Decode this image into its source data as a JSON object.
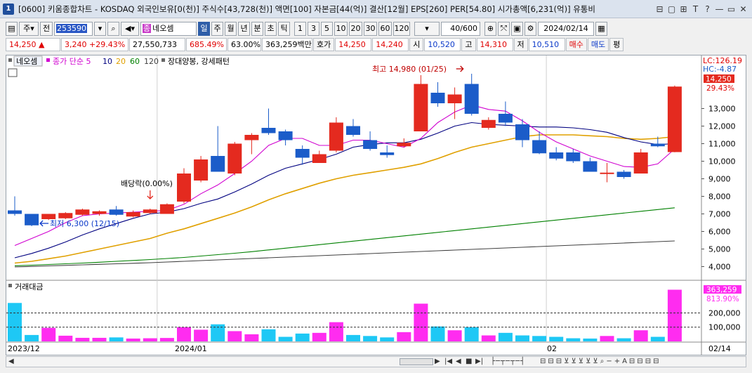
{
  "window": {
    "number": "1",
    "title": "[0600] 키움종합차트 - KOSDAQ 외국인보유[0(천)] 주식수[43,728(천)] 액면[100] 자본금[44(억)] 결산[12월] EPS[260] PER[54.80] 시가총액[6,231(억)] 유통비",
    "buttons": [
      "⊟",
      "▢",
      "⊞",
      "T",
      "?",
      "—",
      "▭",
      "✕"
    ]
  },
  "toolbar": {
    "mode_label": "주",
    "full_label": "전",
    "stock_code": "253590",
    "stock_name": "네오셈",
    "stock_badge": "종",
    "periods": [
      "일",
      "주",
      "월",
      "년",
      "분",
      "초",
      "틱"
    ],
    "active_period": "일",
    "intervals": [
      "1",
      "3",
      "5",
      "10",
      "20",
      "30",
      "60",
      "120"
    ],
    "count": "40/600",
    "date": "2024/02/14"
  },
  "quote": {
    "price": "14,250",
    "change": "3,240",
    "change_pct": "+29.43%",
    "volume": "27,550,733",
    "volume_pct": "685.49%",
    "ratio": "63.00%",
    "amount": "363,259백만",
    "ask_label": "호가",
    "ask": "14,250",
    "bid": "14,240",
    "open_label": "시",
    "open": "10,520",
    "high_label": "고",
    "high": "14,310",
    "low_label": "저",
    "low": "10,510",
    "buy_label": "매수",
    "sell_label": "매도",
    "flat_label": "평"
  },
  "chart_data": {
    "type": "candlestick",
    "title": "네오셈",
    "legend": [
      "종가 단순 5",
      "10",
      "20",
      "60",
      "120"
    ],
    "legend_colors": [
      "#d000d0",
      "#000080",
      "#e0a000",
      "#008000",
      "#404040"
    ],
    "pattern_label": "장대양봉, 강세패턴",
    "candles": [
      {
        "o": 7200,
        "h": 8000,
        "l": 6900,
        "c": 7000
      },
      {
        "o": 7000,
        "h": 7000,
        "l": 6300,
        "c": 6350
      },
      {
        "o": 6700,
        "h": 7000,
        "l": 6650,
        "c": 7000
      },
      {
        "o": 6750,
        "h": 7100,
        "l": 6700,
        "c": 7050
      },
      {
        "o": 6950,
        "h": 7300,
        "l": 6900,
        "c": 7250
      },
      {
        "o": 7000,
        "h": 7200,
        "l": 6900,
        "c": 7150
      },
      {
        "o": 7250,
        "h": 7450,
        "l": 6900,
        "c": 6950
      },
      {
        "o": 6850,
        "h": 7200,
        "l": 6800,
        "c": 7100
      },
      {
        "o": 7050,
        "h": 7300,
        "l": 7000,
        "c": 7250
      },
      {
        "o": 7000,
        "h": 7600,
        "l": 7000,
        "c": 7550
      },
      {
        "o": 7700,
        "h": 9600,
        "l": 7600,
        "c": 9300
      },
      {
        "o": 8900,
        "h": 10300,
        "l": 8800,
        "c": 10100
      },
      {
        "o": 10300,
        "h": 12000,
        "l": 9400,
        "c": 9400
      },
      {
        "o": 9300,
        "h": 11100,
        "l": 9200,
        "c": 11000
      },
      {
        "o": 11200,
        "h": 11600,
        "l": 10400,
        "c": 11500
      },
      {
        "o": 11900,
        "h": 13000,
        "l": 11500,
        "c": 11600
      },
      {
        "o": 11700,
        "h": 11800,
        "l": 10900,
        "c": 11200
      },
      {
        "o": 10700,
        "h": 10900,
        "l": 9800,
        "c": 10200
      },
      {
        "o": 9900,
        "h": 10600,
        "l": 9900,
        "c": 10400
      },
      {
        "o": 10600,
        "h": 12500,
        "l": 10500,
        "c": 12200
      },
      {
        "o": 12000,
        "h": 12400,
        "l": 11400,
        "c": 11500
      },
      {
        "o": 11200,
        "h": 11700,
        "l": 10600,
        "c": 10700
      },
      {
        "o": 10500,
        "h": 10900,
        "l": 10200,
        "c": 10350
      },
      {
        "o": 10850,
        "h": 11300,
        "l": 10800,
        "c": 11050
      },
      {
        "o": 11700,
        "h": 14900,
        "l": 11700,
        "c": 14400
      },
      {
        "o": 13900,
        "h": 14500,
        "l": 13100,
        "c": 13300
      },
      {
        "o": 13300,
        "h": 14200,
        "l": 12400,
        "c": 13800
      },
      {
        "o": 14400,
        "h": 14980,
        "l": 12600,
        "c": 12700
      },
      {
        "o": 11900,
        "h": 12500,
        "l": 11800,
        "c": 12350
      },
      {
        "o": 12700,
        "h": 13400,
        "l": 12000,
        "c": 12200
      },
      {
        "o": 12100,
        "h": 12400,
        "l": 10800,
        "c": 11200
      },
      {
        "o": 11200,
        "h": 11700,
        "l": 10400,
        "c": 10450
      },
      {
        "o": 10500,
        "h": 10800,
        "l": 10050,
        "c": 10150
      },
      {
        "o": 10500,
        "h": 10700,
        "l": 9900,
        "c": 10000
      },
      {
        "o": 10000,
        "h": 10200,
        "l": 9400,
        "c": 9400
      },
      {
        "o": 9300,
        "h": 9900,
        "l": 8800,
        "c": 9350
      },
      {
        "o": 9400,
        "h": 9500,
        "l": 9000,
        "c": 9100
      },
      {
        "o": 9300,
        "h": 10700,
        "l": 9300,
        "c": 10500
      },
      {
        "o": 11000,
        "h": 11400,
        "l": 10800,
        "c": 10850
      },
      {
        "o": 10520,
        "h": 14310,
        "l": 10510,
        "c": 14250
      }
    ],
    "ma5": [
      5200,
      5600,
      6000,
      6500,
      6900,
      7000,
      7050,
      7100,
      7150,
      7200,
      7550,
      8150,
      8650,
      9300,
      10000,
      10900,
      11300,
      11300,
      10900,
      10900,
      11200,
      11200,
      11000,
      10800,
      11300,
      12200,
      12800,
      13200,
      12950,
      12850,
      12300,
      11650,
      11100,
      10700,
      10300,
      10000,
      9700,
      9650,
      9850,
      10700
    ],
    "ma10": [
      4500,
      4750,
      5050,
      5400,
      5800,
      6150,
      6450,
      6750,
      7000,
      7100,
      7300,
      7600,
      7850,
      8250,
      8700,
      9200,
      9600,
      9850,
      10100,
      10400,
      10800,
      10950,
      11050,
      11050,
      11250,
      11600,
      12000,
      12200,
      12100,
      12050,
      12000,
      11950,
      11950,
      11900,
      11800,
      11650,
      11350,
      11100,
      10950,
      11000
    ],
    "ma20": [
      4200,
      4300,
      4450,
      4600,
      4800,
      5000,
      5200,
      5400,
      5600,
      5900,
      6150,
      6450,
      6750,
      7050,
      7400,
      7800,
      8150,
      8450,
      8750,
      9000,
      9200,
      9350,
      9500,
      9650,
      9850,
      10150,
      10500,
      10800,
      11000,
      11200,
      11400,
      11500,
      11500,
      11500,
      11450,
      11400,
      11300,
      11250,
      11300,
      11400
    ],
    "ma60": [
      4050,
      4080,
      4120,
      4160,
      4200,
      4250,
      4300,
      4350,
      4400,
      4460,
      4520,
      4600,
      4680,
      4760,
      4850,
      4950,
      5050,
      5150,
      5250,
      5350,
      5450,
      5550,
      5650,
      5750,
      5850,
      5950,
      6050,
      6150,
      6250,
      6350,
      6450,
      6550,
      6650,
      6750,
      6850,
      6950,
      7050,
      7150,
      7250,
      7350
    ],
    "ma120": [
      3980,
      4010,
      4040,
      4070,
      4100,
      4130,
      4160,
      4190,
      4220,
      4260,
      4300,
      4340,
      4380,
      4420,
      4460,
      4500,
      4540,
      4580,
      4620,
      4660,
      4700,
      4740,
      4780,
      4820,
      4860,
      4900,
      4940,
      4980,
      5020,
      5060,
      5100,
      5140,
      5180,
      5220,
      5260,
      5300,
      5340,
      5380,
      5420,
      5460
    ],
    "volume_amount": [
      270,
      45,
      95,
      40,
      25,
      25,
      28,
      20,
      22,
      24,
      100,
      82,
      120,
      72,
      50,
      85,
      32,
      55,
      60,
      135,
      45,
      38,
      28,
      65,
      265,
      105,
      78,
      100,
      42,
      60,
      42,
      38,
      32,
      22,
      20,
      38,
      22,
      78,
      32,
      363
    ],
    "price_ylim": [
      3700,
      15300
    ],
    "price_ticks": [
      "4,000",
      "5,000",
      "6,000",
      "7,000",
      "8,000",
      "9,000",
      "10,000",
      "11,000",
      "12,000",
      "13,000"
    ],
    "volume_ticks": [
      "100,000",
      "200,000"
    ],
    "volume_label": "거래대금",
    "x_labels": [
      "2023/12",
      "2024/01",
      "02",
      "02/14"
    ],
    "annotations": {
      "high": "최고 14,980 (01/25)",
      "low": "최저 6,300 (12/15)",
      "dividend": "배당락(0.00%)"
    },
    "right_labels": {
      "lc": "LC:126.19",
      "hc": "HC:-4.87",
      "current_price": "14,250",
      "current_pct": "29.43%",
      "current_volume": "363,259",
      "volume_pct": "813.90%"
    },
    "colors": {
      "up": "#e42a1f",
      "down": "#1b5cc9",
      "vol_up": "#ff2cf0",
      "vol_down": "#1ec8f5"
    }
  },
  "scroll_controls": [
    "▶",
    "|◀",
    "◀",
    "■",
    "▶|"
  ]
}
